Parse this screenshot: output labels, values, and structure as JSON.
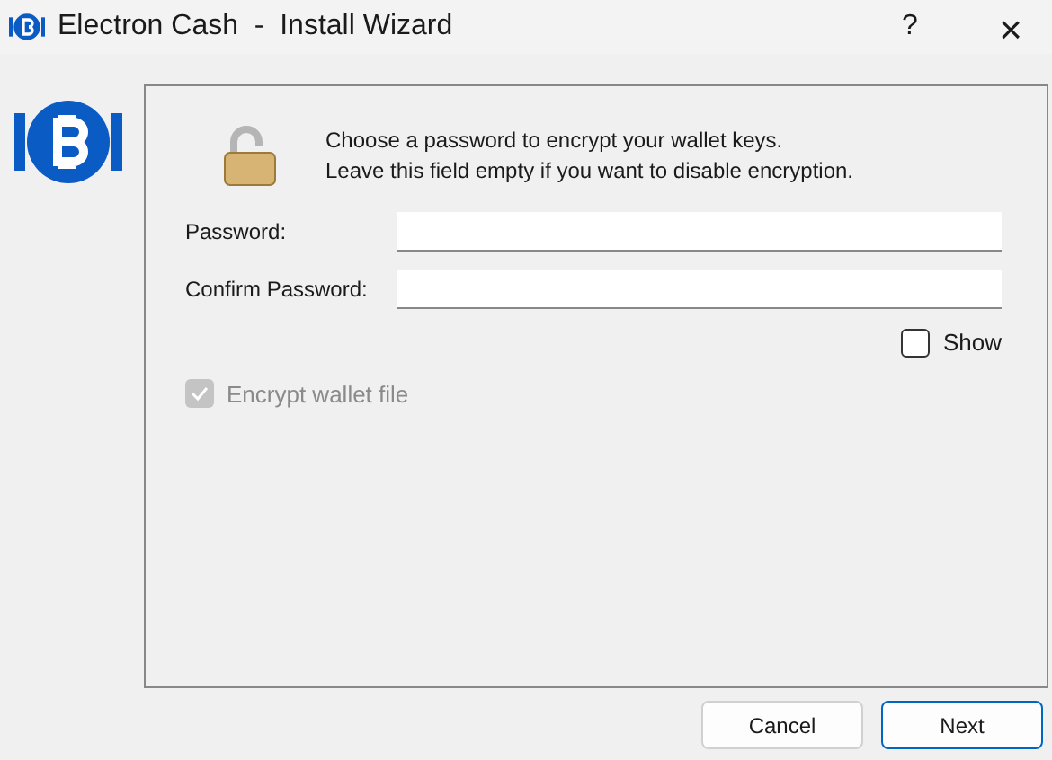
{
  "window": {
    "title": "Electron Cash  -  Install Wizard",
    "help": "?",
    "close": "×"
  },
  "message": [
    "Choose a password to encrypt your wallet keys.",
    "Leave this field empty if you want to disable encryption."
  ],
  "fields": [
    {
      "label": "Password:"
    },
    {
      "label": "Confirm Password:"
    }
  ],
  "show": {
    "label": "Show",
    "checked": false
  },
  "encrypt": {
    "label": "Encrypt wallet file",
    "checked": true,
    "disabled": true
  },
  "buttons": [
    {
      "label": "Cancel",
      "default": false
    },
    {
      "label": "Next",
      "default": true
    }
  ]
}
